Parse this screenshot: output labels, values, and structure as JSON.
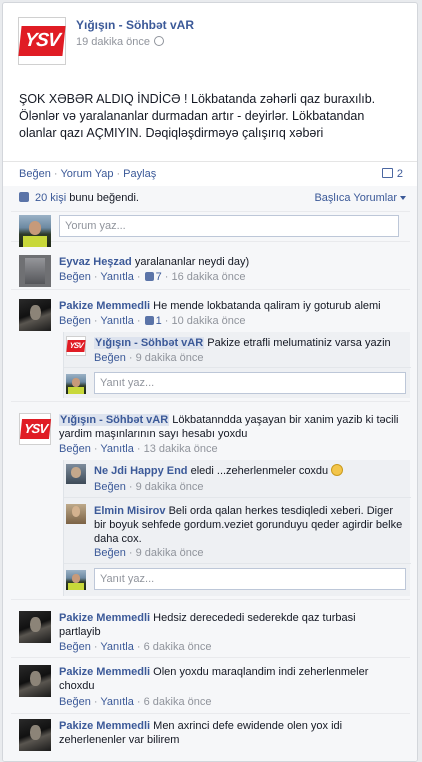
{
  "post": {
    "author": "Yığışın - Söhbət vAR",
    "logo_text": "YSV",
    "time": "19 dakika önce",
    "text": "ŞOK XƏBƏR ALDIQ İNDİCƏ ! Lökbatanda zəhərli qaz buraxılıb. Ölənlər və yaralananlar durmadan artır - deyirlər. Lökbatandan olanlar qazı AÇMIYIN. Dəqiqləşdirməyə çalışırıq xəbəri"
  },
  "actions": {
    "like": "Beğen",
    "comment": "Yorum Yap",
    "share": "Paylaş",
    "comment_count": "2"
  },
  "likes": {
    "count_text": "20 kişi",
    "suffix": " bunu beğendi.",
    "sort_label": "Başlıca Yorumlar"
  },
  "compose": {
    "placeholder": "Yorum yaz..."
  },
  "labels": {
    "like": "Beğen",
    "reply": "Yanıtla",
    "reply_placeholder": "Yanıt yaz..."
  },
  "comments": [
    {
      "author": "Eyvaz Heşzad",
      "text": "yaralananlar neydi day)",
      "likes": "7",
      "time": "16 dakika önce"
    },
    {
      "author": "Pakize Memmedli",
      "text": "He mende lokbatanda qaliram iy goturub alemi",
      "likes": "1",
      "time": "10 dakika önce",
      "replies": [
        {
          "author": "Yığışın - Söhbət vAR",
          "text": "Pakize etrafli melumatiniz varsa yazin",
          "time": "9 dakika önce"
        }
      ]
    },
    {
      "author": "Yığışın - Söhbət vAR",
      "text": "Lökbatanndda yaşayan bir xanim yazib ki tәcili yardim maşınlarının sayı hesabı yoxdu",
      "time": "13 dakika önce",
      "replies": [
        {
          "author": "Ne Jdi Happy End",
          "text": "eledi ...zeherlenmeler coxdu",
          "time": "9 dakika önce"
        },
        {
          "author": "Elmin Misirov",
          "text": "Beli orda qalan herkes tesdiqledi xeberi. Diger bir boyuk sehfede gordum.veziet gorunduyu qeder agirdir belke daha cox.",
          "time": "9 dakika önce"
        }
      ]
    },
    {
      "author": "Pakize Memmedli",
      "text": "Hedsiz derecededi sederekde qaz turbasi partlayib",
      "time": "6 dakika önce"
    },
    {
      "author": "Pakize Memmedli",
      "text": "Olen yoxdu maraqlandim indi zeherlenmeler choxdu",
      "time": "6 dakika önce"
    },
    {
      "author": "Pakize Memmedli",
      "text": "Men axrinci defe ewidende olen yox idi zeherlenenler var bilirem"
    }
  ]
}
